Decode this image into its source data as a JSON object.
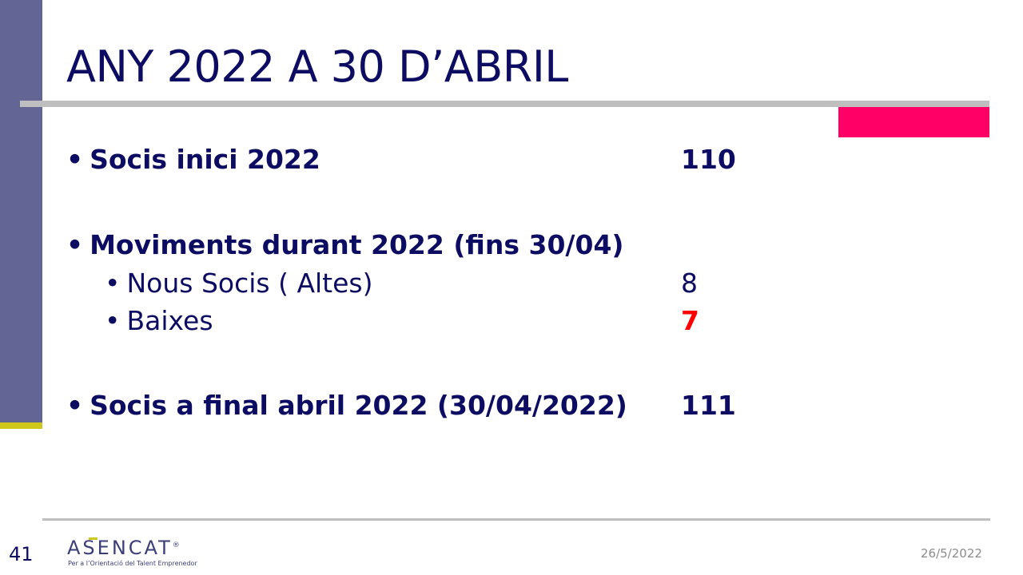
{
  "slide": {
    "title": "ANY 2022 A 30 D’ABRIL",
    "items": [
      {
        "bullet": "•",
        "label": "Socis inici 2022",
        "value": "110"
      },
      {
        "bullet": "•",
        "label": "Moviments durant 2022 (fins 30/04)",
        "value": ""
      },
      {
        "bullet": "•",
        "label": "Nous Socis ( Altes)",
        "value": "8"
      },
      {
        "bullet": "•",
        "label": "Baixes",
        "value": "7"
      },
      {
        "bullet": "•",
        "label": "Socis  a final abril 2022 (30/04/2022)",
        "value": "111"
      }
    ]
  },
  "footer": {
    "slide_number": "41",
    "logo_text": "ASENCAT",
    "logo_registered": "®",
    "logo_tagline": "Per a l’Orientació del Talent Emprenedor",
    "date": "26/5/2022"
  },
  "colors": {
    "title_text": "#0c0c62",
    "sidebar": "#636695",
    "sidebar_accent": "#cfc81a",
    "pink_block": "#ff0066",
    "rule": "#bfbfbf",
    "highlight_value": "#ff0000"
  }
}
